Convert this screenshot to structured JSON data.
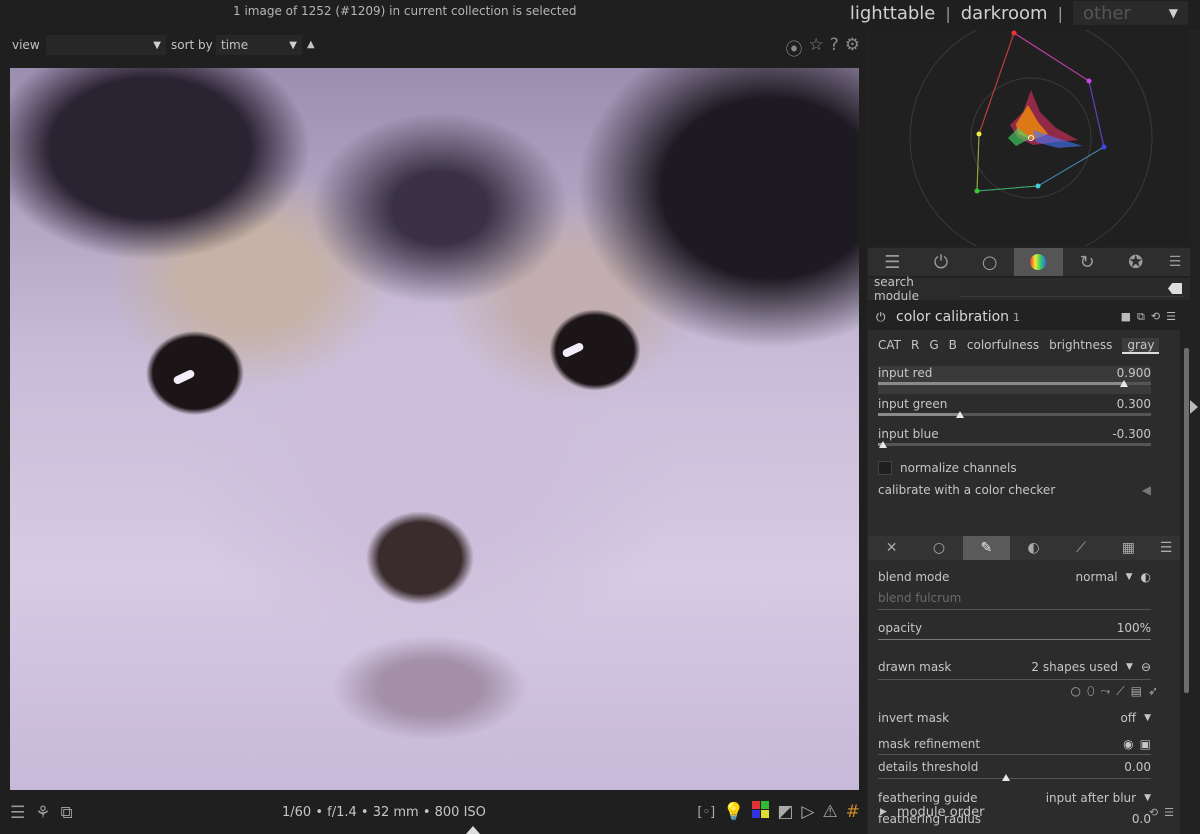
{
  "header": {
    "status": "1 image of 1252 (#1209) in current collection is selected",
    "views": [
      "lighttable",
      "darkroom"
    ],
    "other_view": "other"
  },
  "filter_bar": {
    "view_label": "view",
    "view_value": "",
    "sort_label": "sort by",
    "sort_value": "time"
  },
  "module_group_tabs": [
    "sliders-icon",
    "power-icon",
    "circle-icon",
    "color-wheel-icon",
    "rotate-icon",
    "aperture-icon",
    "hamburger-icon"
  ],
  "search": {
    "label": "search module",
    "value": ""
  },
  "module": {
    "name": "color calibration",
    "instance": "1",
    "subtabs": [
      "CAT",
      "R",
      "G",
      "B",
      "colorfulness",
      "brightness",
      "gray"
    ],
    "active_subtab": "gray",
    "sliders": [
      {
        "label": "input red",
        "value": "0.900",
        "fraction": 0.9
      },
      {
        "label": "input green",
        "value": "0.300",
        "fraction": 0.3
      },
      {
        "label": "input blue",
        "value": "-0.300",
        "fraction": 0.02
      }
    ],
    "normalize_label": "normalize channels",
    "calibrate_label": "calibrate with a color checker"
  },
  "blending": {
    "blend_mode_label": "blend mode",
    "blend_mode_value": "normal",
    "blend_fulcrum_label": "blend fulcrum",
    "opacity_label": "opacity",
    "opacity_value": "100%",
    "drawn_mask_label": "drawn mask",
    "drawn_mask_value": "2 shapes used",
    "invert_mask_label": "invert mask",
    "invert_mask_value": "off",
    "mask_refinement_label": "mask refinement",
    "details_threshold_label": "details threshold",
    "details_threshold_value": "0.00",
    "feathering_guide_label": "feathering guide",
    "feathering_guide_value": "input after blur",
    "feathering_radius_label": "feathering radius",
    "feathering_radius_value": "0.0"
  },
  "module_order_label": "module order",
  "bottom": {
    "exif": "1/60 • f/1.4 • 32 mm • 800 ISO"
  },
  "colors": {
    "active_tab_bg": "#555555",
    "panel_bg": "#2c2c2c",
    "app_bg": "#1f1f1f"
  }
}
